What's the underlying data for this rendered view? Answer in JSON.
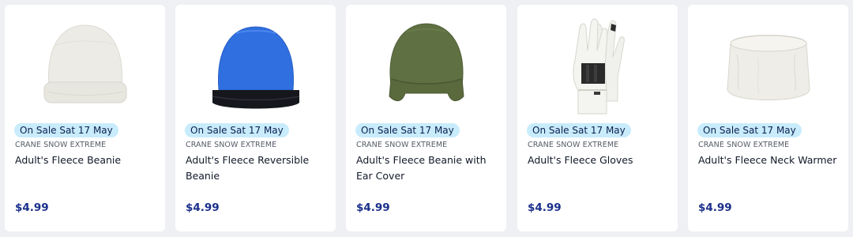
{
  "products": [
    {
      "badge": "On Sale Sat 17 May",
      "brand": "CRANE SNOW EXTREME",
      "title": "Adult's Fleece Beanie",
      "price": "$4.99",
      "image_icon": "white-beanie-image"
    },
    {
      "badge": "On Sale Sat 17 May",
      "brand": "CRANE SNOW EXTREME",
      "title": "Adult's Fleece Reversible Beanie",
      "price": "$4.99",
      "image_icon": "blue-black-reversible-beanie-image"
    },
    {
      "badge": "On Sale Sat 17 May",
      "brand": "CRANE SNOW EXTREME",
      "title": "Adult's Fleece Beanie with Ear Cover",
      "price": "$4.99",
      "image_icon": "green-ear-cover-beanie-image"
    },
    {
      "badge": "On Sale Sat 17 May",
      "brand": "CRANE SNOW EXTREME",
      "title": "Adult's Fleece Gloves",
      "price": "$4.99",
      "image_icon": "white-gloves-image"
    },
    {
      "badge": "On Sale Sat 17 May",
      "brand": "CRANE SNOW EXTREME",
      "title": "Adult's Fleece Neck Warmer",
      "price": "$4.99",
      "image_icon": "white-neck-warmer-image"
    }
  ],
  "colors": {
    "page_background": "#eff0f3",
    "card_background": "#ffffff",
    "badge_background": "#c8ecfb",
    "price_text": "#1a2f8a"
  }
}
